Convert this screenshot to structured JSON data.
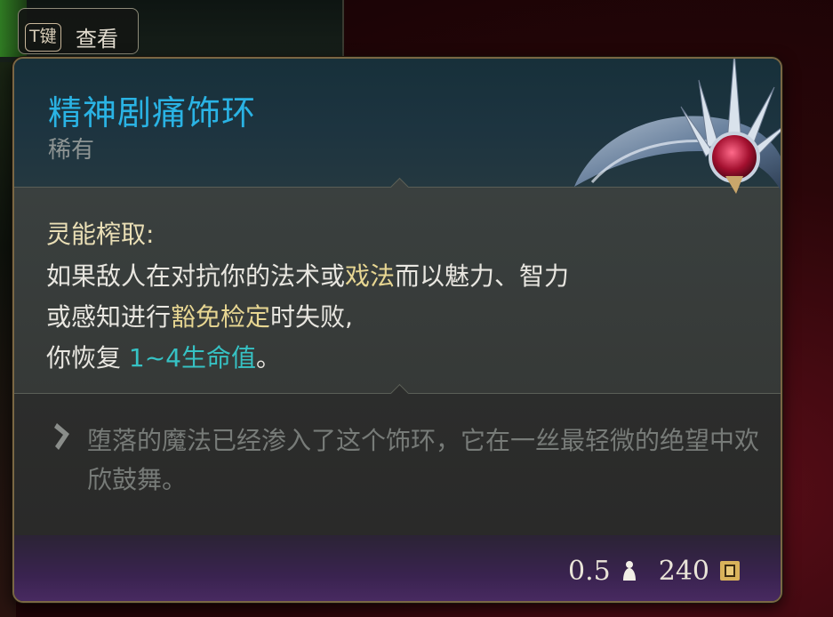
{
  "hint": {
    "key": "T键",
    "label": "查看"
  },
  "item": {
    "name": "精神剧痛饰环",
    "rarity": "稀有"
  },
  "ability": {
    "name": "灵能榨取:",
    "desc_1": "如果敌人在对抗你的法术或",
    "kw_1": "戏法",
    "desc_2": "而以魅力、智力或感知进行",
    "kw_2": "豁免检定",
    "desc_3": "时失败,",
    "desc_4": "你恢复 ",
    "heal": "1~4生命值",
    "desc_5": "。"
  },
  "flavor": "堕落的魔法已经渗入了这个饰环，它在一丝最轻微的绝望中欢欣鼓舞。",
  "footer": {
    "weight": "0.5",
    "value": "240"
  },
  "colors": {
    "title": "#2ab3e4",
    "keyword": "#e7d692",
    "heal": "#36c2c4",
    "border": "#7a6744"
  },
  "icons": {
    "flavor": "quill-icon",
    "weight": "weight-icon",
    "gold": "gold-icon",
    "item": "circlet-icon"
  }
}
